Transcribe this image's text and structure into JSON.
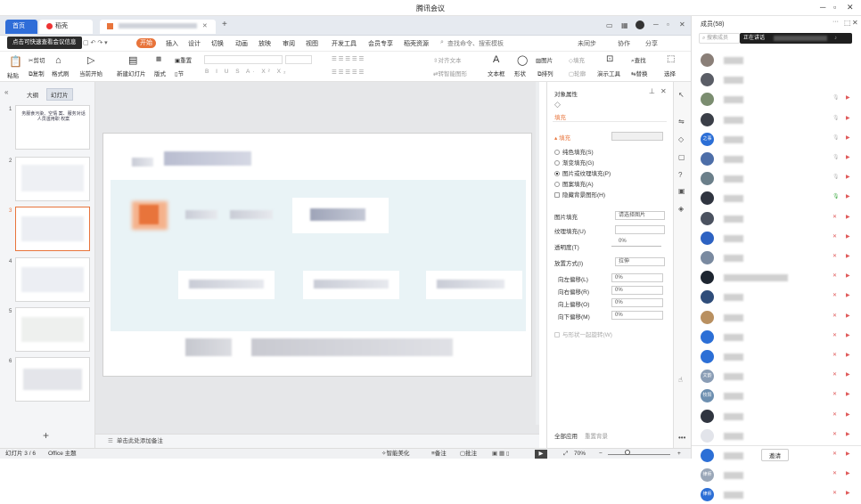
{
  "window": {
    "title": "腾讯会议"
  },
  "tabs": {
    "home": "首页",
    "docer": "稻壳",
    "new_tab": "+"
  },
  "tip": {
    "text": "点击可快速查看会议信息"
  },
  "ribbon": {
    "tabs": [
      "开始",
      "插入",
      "设计",
      "切换",
      "动画",
      "放映",
      "审阅",
      "视图",
      "开发工具",
      "会员专享",
      "稻壳资源"
    ],
    "search": "查找命令、搜索模板",
    "right": [
      "未同步",
      "协作",
      "分享"
    ]
  },
  "toolbar": {
    "paste": "粘贴",
    "cut": "剪切",
    "copy": "复制",
    "format_painter": "格式刷",
    "from_current": "当前开始",
    "new_slide": "新建幻灯片",
    "layout": "版式",
    "section": "节",
    "reset": "重置",
    "text_box": "文本框",
    "shape": "形状",
    "arrange": "排列",
    "outline": "轮廓",
    "picture": "图片",
    "fill": "填充",
    "find": "查找",
    "replace": "替换",
    "select": "选择",
    "present_tools": "演示工具",
    "align_text": "对齐文本",
    "smartart": "转智能图形"
  },
  "leftpane": {
    "outline_tab": "大纲",
    "slides_tab": "幻灯片",
    "thumb1_text": "务服食污染、空情 案、服务对话人员滥用职 权案",
    "numbers": [
      "1",
      "2",
      "3",
      "4",
      "5",
      "6"
    ],
    "add": "+"
  },
  "notes": {
    "placeholder": "单击此处添加备注"
  },
  "status": {
    "slide": "幻灯片 3 / 6",
    "theme": "Office 主题",
    "smart": "智能美化",
    "notes": "备注",
    "comment": "批注",
    "zoom": "70%"
  },
  "props": {
    "title": "对象属性",
    "section_fill": "填充",
    "fill_header": "填充",
    "options": [
      "纯色填充(S)",
      "渐变填充(G)",
      "图片或纹理填充(P)",
      "图案填充(A)",
      "隐藏背景图形(H)"
    ],
    "selected_option": 2,
    "picture_fill_label": "图片填充",
    "picture_fill_value": "请选择图片",
    "texture_label": "纹理填充(U)",
    "transparency_label": "透明度(T)",
    "transparency_value": "0%",
    "placement_label": "放置方式(I)",
    "placement_value": "拉伸",
    "offsets": [
      {
        "label": "向左偏移(L)",
        "value": "0%"
      },
      {
        "label": "向右偏移(R)",
        "value": "0%"
      },
      {
        "label": "向上偏移(O)",
        "value": "0%"
      },
      {
        "label": "向下偏移(M)",
        "value": "0%"
      }
    ],
    "tile_with_shape": "与形状一起旋转(W)",
    "apply_all": "全部应用",
    "reset_bg": "重置背景"
  },
  "members": {
    "title": "成员(58)",
    "search_placeholder": "搜索成员",
    "speaking": "正在讲话",
    "invite": "邀请",
    "avatar_labels": {
      "r5": "之事",
      "r17": "文韵",
      "r18": "牧阳",
      "r22": "律师",
      "r24": "律师"
    },
    "more": "···"
  }
}
